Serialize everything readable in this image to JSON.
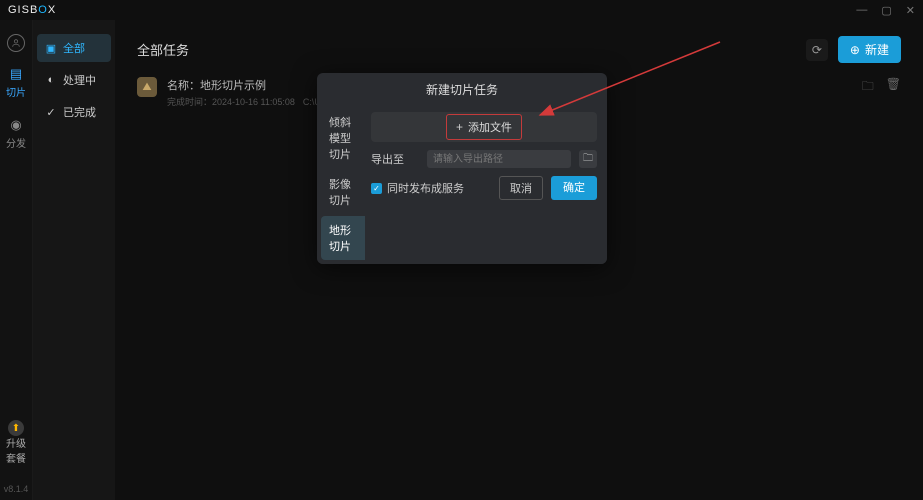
{
  "app": {
    "name_pre": "GISB",
    "name_o": "O",
    "name_post": "X",
    "version": "v8.1.4"
  },
  "window_controls": {
    "min": "—",
    "max": "▢",
    "close": "✕"
  },
  "rail": {
    "items": [
      {
        "icon": "▤",
        "label": "切片"
      },
      {
        "icon": "◉",
        "label": "分发"
      }
    ],
    "upgrade_icon": "⬆",
    "upgrade_line1": "升级",
    "upgrade_line2": "套餐"
  },
  "sidebar": {
    "items": [
      {
        "icon": "▣",
        "label": "全部"
      },
      {
        "icon": "◐",
        "label": "处理中"
      },
      {
        "icon": "✓",
        "label": "已完成"
      }
    ]
  },
  "header": {
    "title": "全部任务",
    "refresh_icon": "⟳",
    "new_icon": "⊕",
    "new_label": "新建"
  },
  "tasks": [
    {
      "thumb_icon": "⛰",
      "name_prefix": "名称：",
      "name": "地形切片示例",
      "time_prefix": "完成时间：",
      "time": "2024-10-16 11:05:08",
      "path": "C:\\Users\\admin\\Desktop\\地形",
      "action_open": "🗀",
      "action_delete": "🗑"
    }
  ],
  "modal": {
    "title": "新建切片任务",
    "nav": [
      {
        "label": "倾斜模型切片"
      },
      {
        "label": "影像切片"
      },
      {
        "label": "地形切片"
      }
    ],
    "add_plus": "+",
    "add_file_label": "添加文件",
    "export_label": "导出至",
    "export_placeholder": "请输入导出路径",
    "browse_icon": "🗀",
    "checkbox_check": "✓",
    "checkbox_label": "同时发布成服务",
    "cancel_label": "取消",
    "confirm_label": "确定"
  }
}
